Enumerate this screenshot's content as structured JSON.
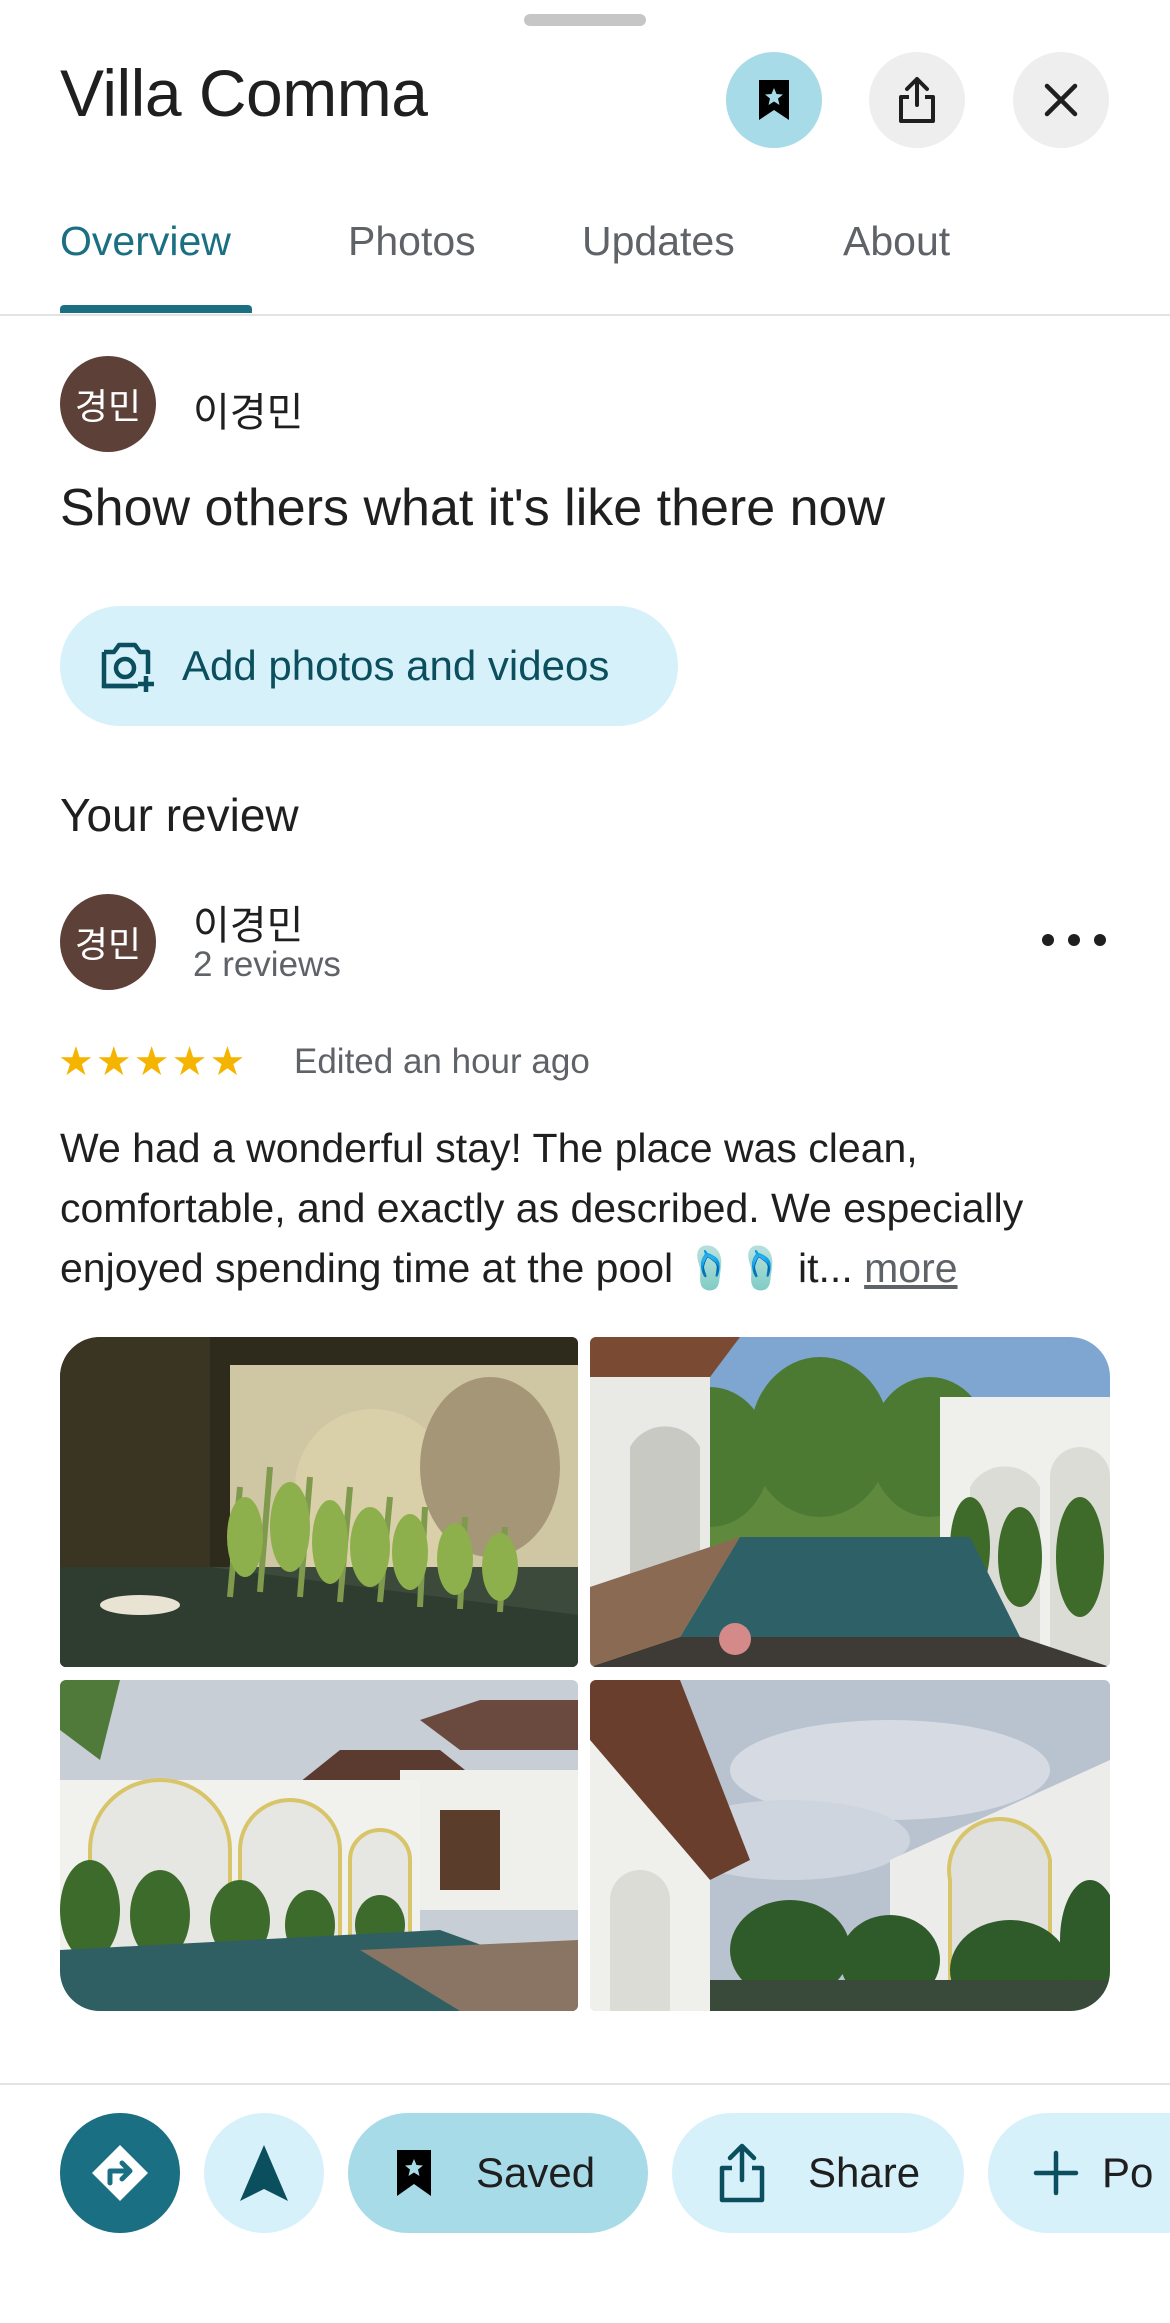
{
  "header": {
    "title": "Villa Comma",
    "save_icon": "bookmark-icon",
    "share_icon": "share-icon",
    "close_icon": "close-icon"
  },
  "tabs": [
    {
      "label": "Overview",
      "active": true
    },
    {
      "label": "Photos",
      "active": false
    },
    {
      "label": "Updates",
      "active": false
    },
    {
      "label": "About",
      "active": false
    }
  ],
  "contribute": {
    "avatar_text": "경민",
    "user_name": "이경민",
    "prompt": "Show others what it's like there now",
    "add_button_label": "Add photos and videos"
  },
  "review": {
    "section_title": "Your review",
    "avatar_text": "경민",
    "user_name": "이경민",
    "review_count": "2 reviews",
    "rating": 5,
    "edited": "Edited an hour ago",
    "text": "We had a wonderful stay! The place was clean, comfortable, and exactly as described. We especially enjoyed spending time at the pool 🩴🩴 it...",
    "more_label": "more",
    "photos": [
      "pool-night-projection",
      "pool-garden-day",
      "pool-arches-evening",
      "courtyard-sky"
    ]
  },
  "actions": {
    "saved_label": "Saved",
    "share_label": "Share",
    "post_label": "Po"
  },
  "colors": {
    "accent": "#1b6f82",
    "chip_bg": "#d6f1fa",
    "saved_bg": "#a8dbe8",
    "star": "#f4b400",
    "avatar_bg": "#5d4037"
  }
}
